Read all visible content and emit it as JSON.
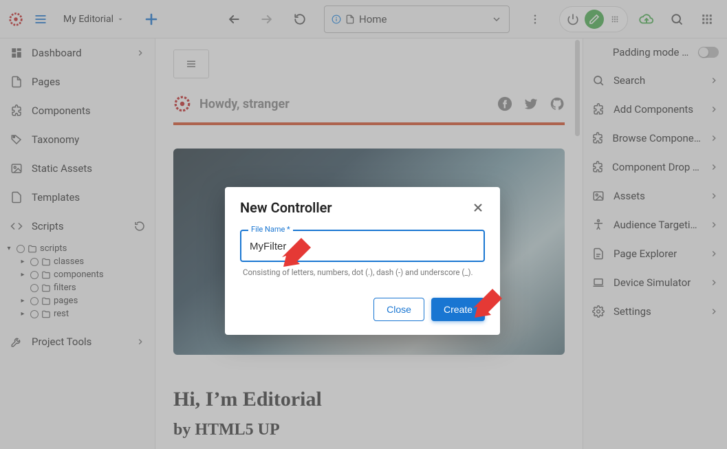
{
  "top": {
    "site_name": "My Editorial",
    "url_label": "Home"
  },
  "left_nav": {
    "dashboard": "Dashboard",
    "pages": "Pages",
    "components": "Components",
    "taxonomy": "Taxonomy",
    "static_assets": "Static Assets",
    "templates": "Templates",
    "scripts": "Scripts",
    "project_tools": "Project Tools"
  },
  "tree": {
    "root": "scripts",
    "classes": "classes",
    "components": "components",
    "filters": "filters",
    "pages": "pages",
    "rest": "rest"
  },
  "right_panel": {
    "padding_mode": "Padding mode (p)",
    "search": "Search",
    "add_components": "Add Components",
    "browse_components": "Browse Components",
    "component_drop": "Component Drop Ta...",
    "assets": "Assets",
    "audience_targeting": "Audience Targeting",
    "page_explorer": "Page Explorer",
    "device_simulator": "Device Simulator",
    "settings": "Settings"
  },
  "preview": {
    "greeting": "Howdy, stranger",
    "h1": "Hi, I’m Editorial",
    "h2": "by HTML5 UP"
  },
  "modal": {
    "title": "New Controller",
    "field_label": "File Name *",
    "field_value": "MyFilter",
    "helper": "Consisting of letters, numbers, dot (.), dash (-) and underscore (_).",
    "close": "Close",
    "create": "Create"
  }
}
